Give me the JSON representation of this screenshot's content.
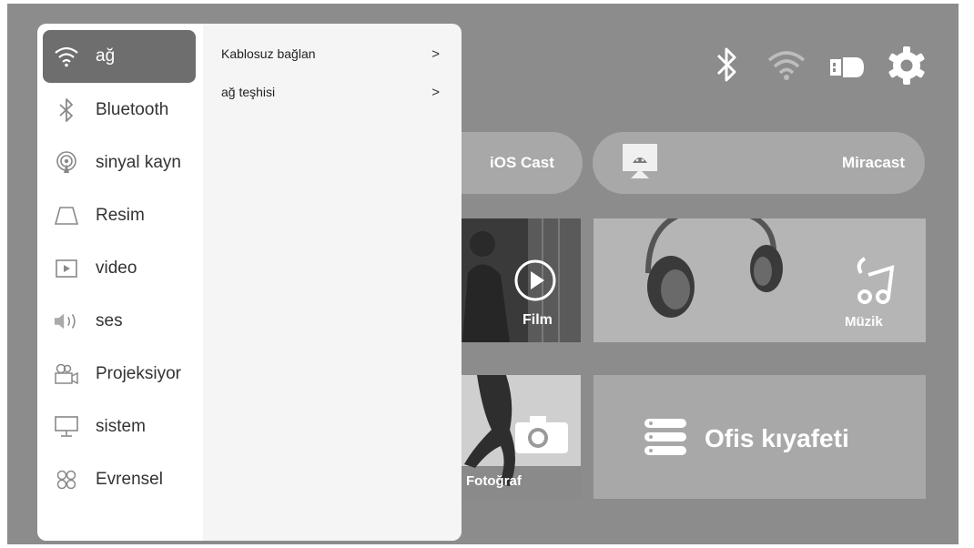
{
  "colors": {
    "background": "#8c8c8c",
    "panel": "#f5f5f5",
    "menu_bg": "#ffffff",
    "selected_item": "#6e6e6e",
    "tile": "#a8a8a8"
  },
  "status_icons": [
    "bluetooth-icon",
    "wifi-icon",
    "input-source-icon",
    "gear-icon"
  ],
  "cast": {
    "ios_cast_label": "iOS Cast",
    "miracast_label": "Miracast"
  },
  "tiles": {
    "film_label": "Film",
    "music_label": "Müzik",
    "photo_label": "Fotoğraf",
    "office_label": "Ofis kıyafeti"
  },
  "menu": {
    "items": [
      {
        "label": "ağ",
        "icon": "wifi-icon",
        "selected": true
      },
      {
        "label": "Bluetooth",
        "icon": "bluetooth-icon",
        "selected": false
      },
      {
        "label": "sinyal kayn",
        "icon": "signal-source-icon",
        "selected": false
      },
      {
        "label": "Resim",
        "icon": "picture-icon",
        "selected": false
      },
      {
        "label": "video",
        "icon": "video-icon",
        "selected": false
      },
      {
        "label": "ses",
        "icon": "speaker-icon",
        "selected": false
      },
      {
        "label": "Projeksiyor",
        "icon": "projector-icon",
        "selected": false
      },
      {
        "label": "sistem",
        "icon": "monitor-icon",
        "selected": false
      },
      {
        "label": "Evrensel",
        "icon": "universal-icon",
        "selected": false
      }
    ]
  },
  "submenu": {
    "items": [
      {
        "label": "Kablosuz bağlan",
        "chevron": ">"
      },
      {
        "label": "ağ teşhisi",
        "chevron": ">"
      }
    ]
  }
}
